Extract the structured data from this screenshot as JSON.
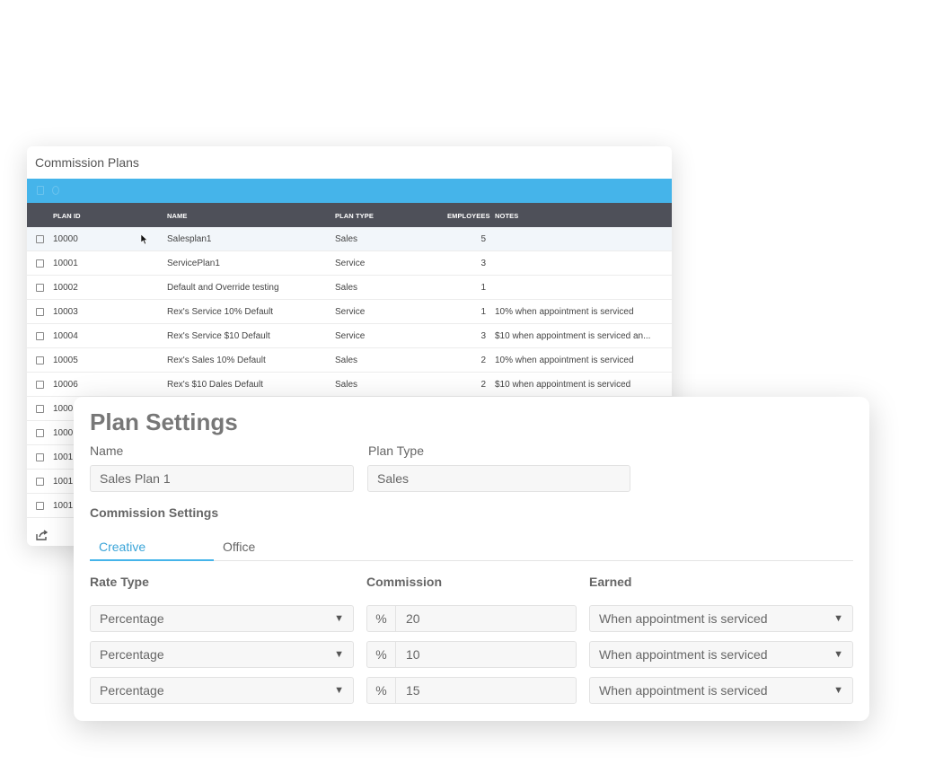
{
  "plans": {
    "title": "Commission Plans",
    "columns": {
      "plan_id": "PLAN ID",
      "name": "NAME",
      "plan_type": "PLAN TYPE",
      "employees": "EMPLOYEES",
      "notes": "NOTES"
    },
    "rows": [
      {
        "id": "10000",
        "name": "Salesplan1",
        "type": "Sales",
        "employees": "5",
        "notes": ""
      },
      {
        "id": "10001",
        "name": "ServicePlan1",
        "type": "Service",
        "employees": "3",
        "notes": ""
      },
      {
        "id": "10002",
        "name": "Default and Override testing",
        "type": "Sales",
        "employees": "1",
        "notes": ""
      },
      {
        "id": "10003",
        "name": "Rex's Service 10% Default",
        "type": "Service",
        "employees": "1",
        "notes": "10% when appointment is serviced"
      },
      {
        "id": "10004",
        "name": "Rex's Service $10 Default",
        "type": "Service",
        "employees": "3",
        "notes": "$10 when appointment is serviced an..."
      },
      {
        "id": "10005",
        "name": "Rex's Sales 10% Default",
        "type": "Sales",
        "employees": "2",
        "notes": "10% when appointment is serviced"
      },
      {
        "id": "10006",
        "name": "Rex's $10 Dales Default",
        "type": "Sales",
        "employees": "2",
        "notes": "$10 when appointment is serviced"
      },
      {
        "id": "1000",
        "name": "",
        "type": "",
        "employees": "",
        "notes": ""
      },
      {
        "id": "1000",
        "name": "",
        "type": "",
        "employees": "",
        "notes": ""
      },
      {
        "id": "1001",
        "name": "",
        "type": "",
        "employees": "",
        "notes": ""
      },
      {
        "id": "1001",
        "name": "",
        "type": "",
        "employees": "",
        "notes": ""
      },
      {
        "id": "1001",
        "name": "",
        "type": "",
        "employees": "",
        "notes": ""
      }
    ],
    "toolbar_icons": [
      "trash-icon",
      "refresh-icon"
    ],
    "footer_icon": "share-icon"
  },
  "settings": {
    "title": "Plan Settings",
    "name_label": "Name",
    "name_value": "Sales Plan 1",
    "type_label": "Plan Type",
    "type_value": "Sales",
    "commission_settings_label": "Commission Settings",
    "tabs": [
      {
        "label": "Creative",
        "active": true
      },
      {
        "label": "Office",
        "active": false
      }
    ],
    "col_rate_type": "Rate Type",
    "col_commission": "Commission",
    "col_earned": "Earned",
    "percent_symbol": "%",
    "dropdown_arrow": "▼",
    "rows": [
      {
        "rate_type": "Percentage",
        "commission": "20",
        "earned": "When appointment is serviced"
      },
      {
        "rate_type": "Percentage",
        "commission": "10",
        "earned": "When appointment is serviced"
      },
      {
        "rate_type": "Percentage",
        "commission": "15",
        "earned": "When appointment is serviced"
      }
    ]
  },
  "colors": {
    "toolbar": "#45b4ea",
    "header": "#4e5059",
    "accent": "#3aa4d8"
  }
}
